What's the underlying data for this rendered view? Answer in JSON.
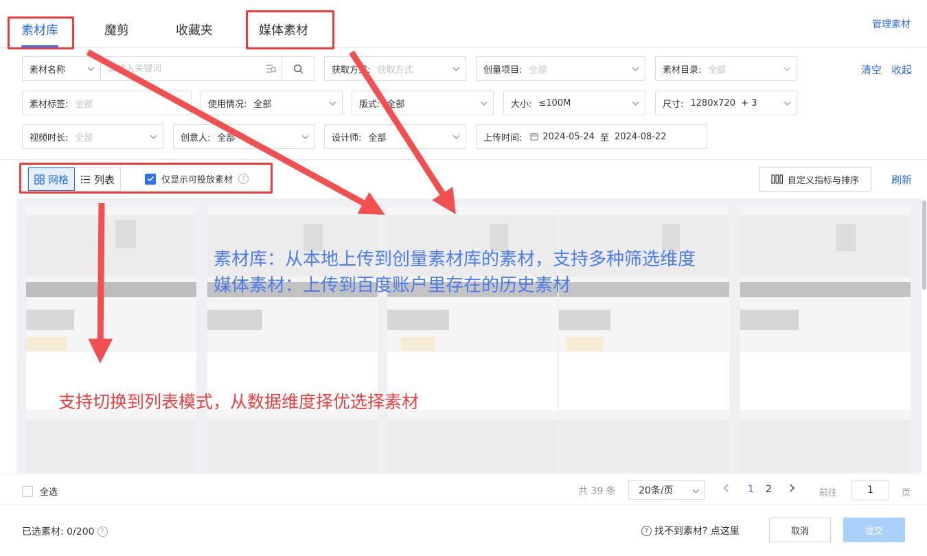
{
  "tabs": [
    {
      "label": "素材库"
    },
    {
      "label": "魔剪"
    },
    {
      "label": "收藏夹"
    },
    {
      "label": "媒体素材"
    }
  ],
  "manage_link": "管理素材",
  "filters": {
    "search": {
      "select_label": "素材名称",
      "placeholder": "请输入关键词"
    },
    "acquire": {
      "label": "获取方式:",
      "value": "获取方式"
    },
    "project": {
      "label": "创量项目:",
      "value": "全部"
    },
    "catalog": {
      "label": "素材目录:",
      "value": "全部"
    },
    "tag": {
      "label": "素材标签:",
      "value": "全部"
    },
    "usage": {
      "label": "使用情况:",
      "value": "全部"
    },
    "format": {
      "label": "版式:",
      "value": "全部"
    },
    "size": {
      "label": "大小:",
      "value": "≤100M"
    },
    "dimension": {
      "label": "尺寸:",
      "value": "1280x720  + 3"
    },
    "duration": {
      "label": "视频时长:",
      "value": "全部"
    },
    "creator": {
      "label": "创意人:",
      "value": "全部"
    },
    "designer": {
      "label": "设计师:",
      "value": "全部"
    },
    "upload_time": {
      "label": "上传时间:",
      "start": "2024-05-24",
      "separator": "至",
      "end": "2024-08-22"
    }
  },
  "clear_link": "清空",
  "collapse_link": "收起",
  "view_toggle": {
    "grid": "网格",
    "list": "列表"
  },
  "only_show": {
    "label": "仅显示可投放素材",
    "checked": true
  },
  "custom_button": "自定义指标与排序",
  "refresh_link": "刷新",
  "pagination": {
    "select_all": "全选",
    "total": "共 39 条",
    "page_size": "20条/页",
    "pages": [
      "1",
      "2"
    ],
    "current_page": "1",
    "goto_label": "前往",
    "goto_value": "1",
    "page_suffix": "页"
  },
  "footer": {
    "selected": "已选素材: 0/200",
    "cant_find": "找不到素材? 点这里",
    "cancel": "取消",
    "submit": "提交"
  },
  "annotations": {
    "blue_line1": "素材库：从本地上传到创量素材库的素材，支持多种筛选维度",
    "blue_line2": "媒体素材：上传到百度账户里存在的历史素材",
    "red_text": "支持切换到列表模式，从数据维度择优选择素材"
  },
  "colors": {
    "accent": "#2e6ff3",
    "annotation_red": "#f03c3c",
    "annotation_blue": "#4c7cf0",
    "submit_disabled": "#a8d0f8"
  }
}
